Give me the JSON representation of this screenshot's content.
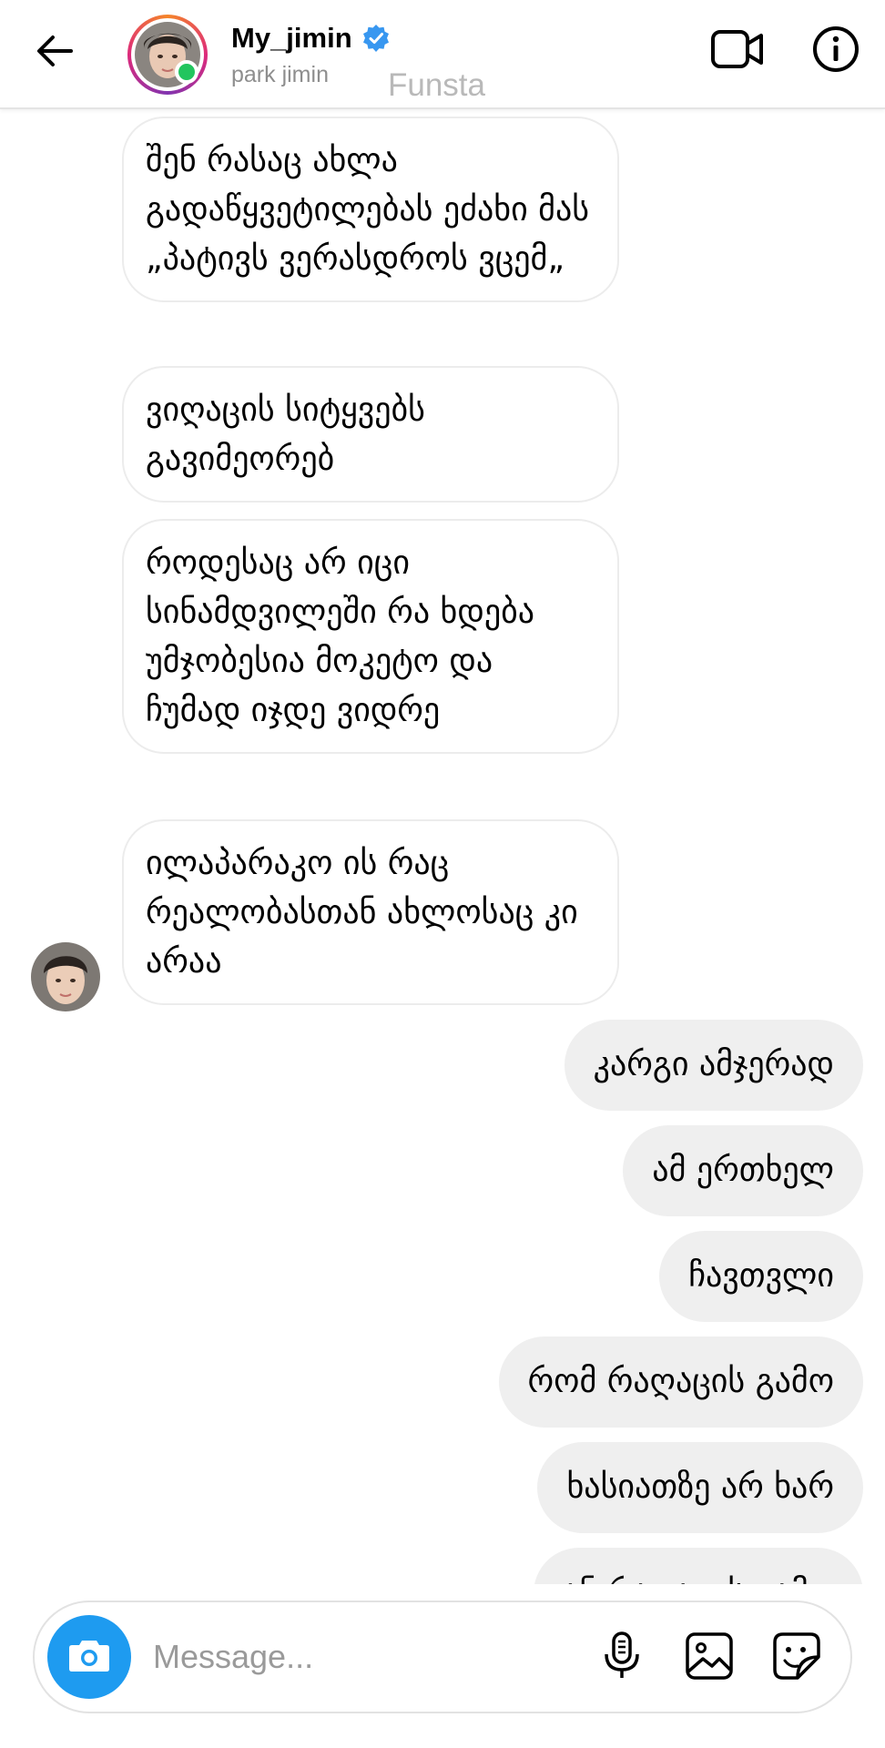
{
  "header": {
    "username": "My_jimin",
    "full_name": "park jimin",
    "watermark": "Funsta",
    "online": true,
    "verified": true,
    "icons": {
      "back": "arrow-left-icon",
      "verified": "verified-badge-icon",
      "video": "video-camera-icon",
      "info": "info-icon"
    },
    "colors": {
      "verified": "#3897f0",
      "online": "#22c55e"
    }
  },
  "thread": {
    "received": [
      "შენ რასაც ახლა გადაწყვეტილებას ეძახი მას „პატივს ვერასდროს ვცემ„",
      "ვიღაცის სიტყვებს გავიმეორებ",
      "როდესაც არ იცი სინამდვილეში რა ხდება უმჯობესია მოკეტო და ჩუმად იჯდე ვიდრე",
      "ილაპარაკო ის რაც რეალობასთან ახლოსაც კი არაა"
    ],
    "sent": [
      "კარგი ამჯერად",
      "ამ ერთხელ",
      "ჩავთვლი",
      "რომ რაღაცის გამო",
      "ხასიათზე არ ხარ",
      "ან რაღაცის გამო"
    ]
  },
  "composer": {
    "placeholder": "Message...",
    "icons": {
      "camera": "camera-icon",
      "microphone": "microphone-icon",
      "gallery": "image-gallery-icon",
      "sticker": "sticker-icon"
    },
    "colors": {
      "camera_button": "#1e9bf0"
    }
  }
}
